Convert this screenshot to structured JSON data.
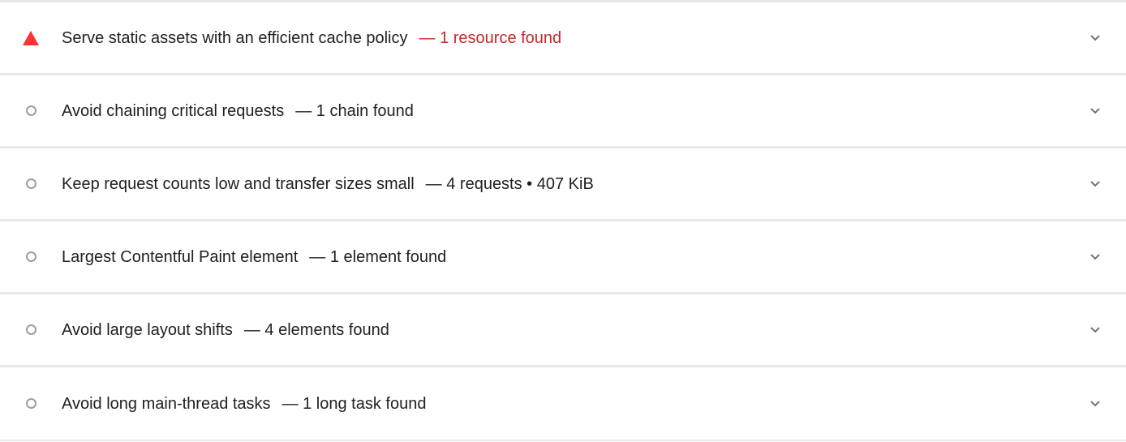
{
  "colors": {
    "fail": "#f33",
    "fail_text": "#c62828",
    "neutral_icon": "#9e9e9e",
    "divider": "#e8e8e8"
  },
  "audits": [
    {
      "title": "Serve static assets with an efficient cache policy",
      "summary": "— 1 resource found",
      "status": "fail",
      "icon": "triangle-warning-icon"
    },
    {
      "title": "Avoid chaining critical requests",
      "summary": "— 1 chain found",
      "status": "informative",
      "icon": "circle-icon"
    },
    {
      "title": "Keep request counts low and transfer sizes small",
      "summary": "— 4 requests • 407 KiB",
      "status": "informative",
      "icon": "circle-icon"
    },
    {
      "title": "Largest Contentful Paint element",
      "summary": "— 1 element found",
      "status": "informative",
      "icon": "circle-icon"
    },
    {
      "title": "Avoid large layout shifts",
      "summary": "— 4 elements found",
      "status": "informative",
      "icon": "circle-icon"
    },
    {
      "title": "Avoid long main-thread tasks",
      "summary": "— 1 long task found",
      "status": "informative",
      "icon": "circle-icon"
    }
  ]
}
